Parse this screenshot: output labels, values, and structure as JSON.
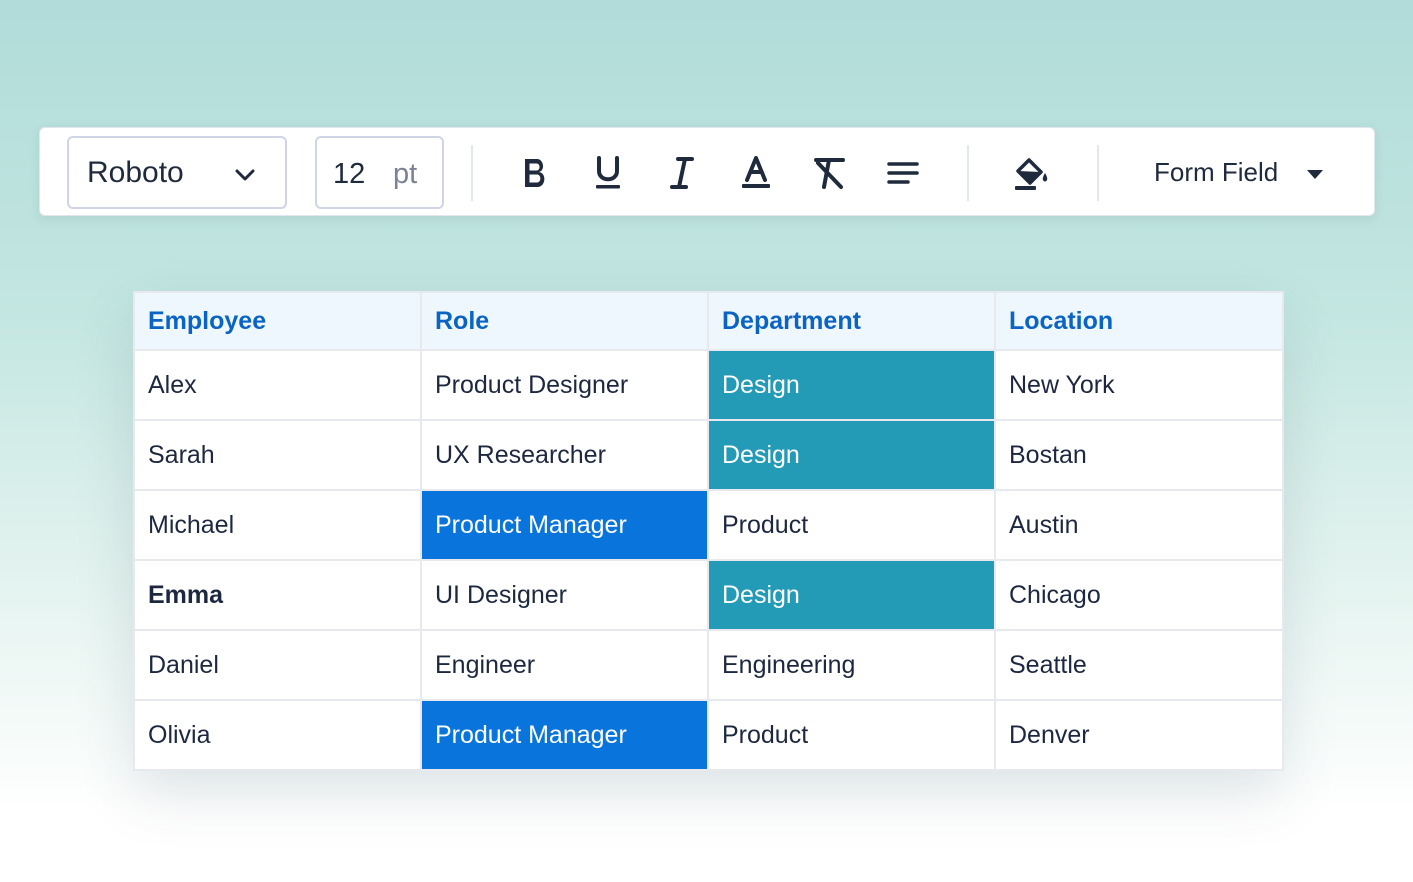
{
  "toolbar": {
    "font_family": "Roboto",
    "font_size": "12",
    "font_size_unit": "pt",
    "form_field_label": "Form Field"
  },
  "table": {
    "headers": [
      "Employee",
      "Role",
      "Department",
      "Location"
    ],
    "rows": [
      [
        "Alex",
        "Product Designer",
        "Design",
        "New York"
      ],
      [
        "Sarah",
        "UX Researcher",
        "Design",
        "Bostan"
      ],
      [
        "Michael",
        "Product Manager",
        "Product",
        "Austin"
      ],
      [
        "Emma",
        "UI Designer",
        "Design",
        "Chicago"
      ],
      [
        "Daniel",
        "Engineer",
        "Engineering",
        "Seattle"
      ],
      [
        "Olivia",
        "Product Manager",
        "Product",
        "Denver"
      ]
    ]
  },
  "colors": {
    "header_text": "#0b63c4",
    "highlight_design": "#239bb7",
    "highlight_product_manager": "#0a74dd"
  },
  "icons": [
    "chevron-down-icon",
    "bold-icon",
    "underline-icon",
    "italic-icon",
    "text-color-icon",
    "clear-format-icon",
    "align-icon",
    "fill-color-icon",
    "caret-down-icon"
  ]
}
